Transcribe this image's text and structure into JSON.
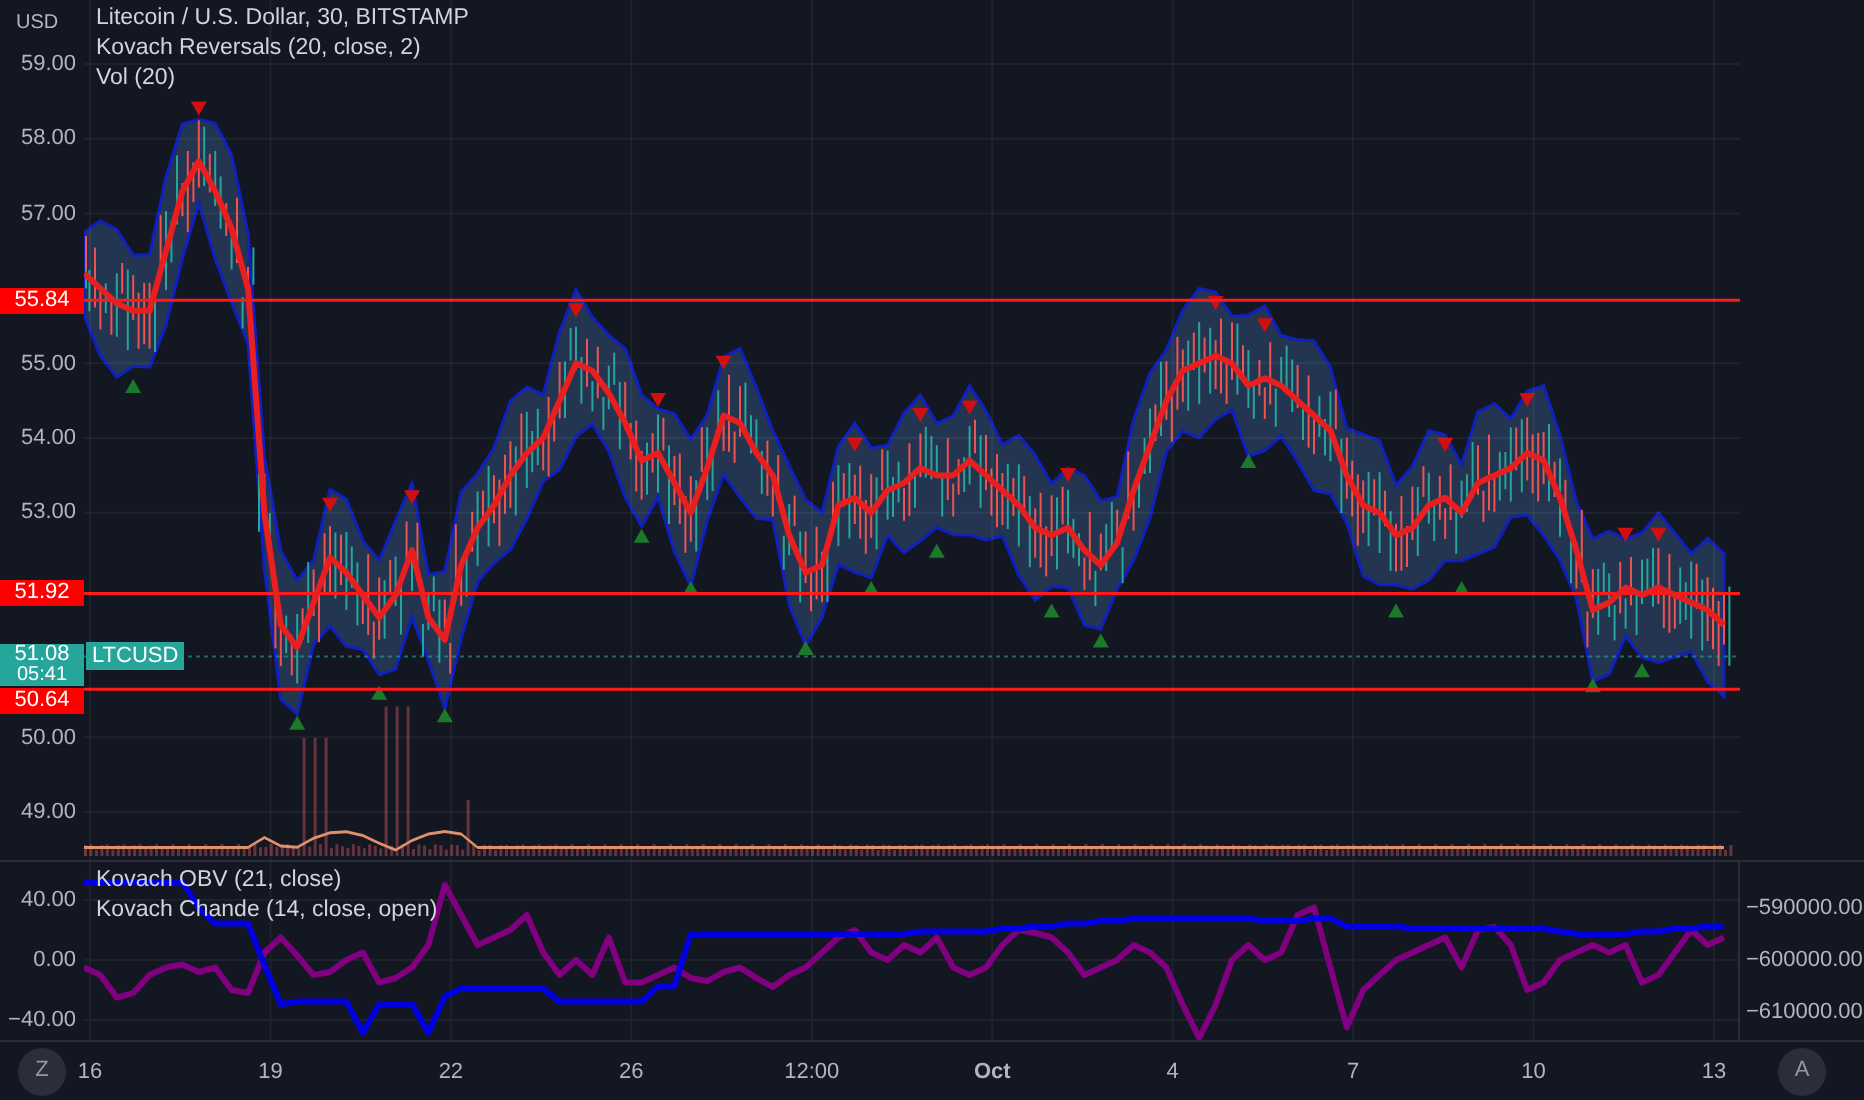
{
  "legend": [
    "Litecoin / U.S. Dollar, 30, BITSTAMP",
    "Kovach Reversals (20, close, 2)",
    "Vol (20)"
  ],
  "currency": "USD",
  "price_chart": {
    "chart_data": {
      "type": "line",
      "grid": true,
      "ylim": [
        49,
        59
      ],
      "yticks": [
        {
          "value": 49,
          "label": "49.00"
        },
        {
          "value": 50,
          "label": "50.00"
        },
        {
          "value": 53,
          "label": "53.00"
        },
        {
          "value": 54,
          "label": "54.00"
        },
        {
          "value": 55,
          "label": "55.00"
        },
        {
          "value": 57,
          "label": "57.00"
        },
        {
          "value": 58,
          "label": "58.00"
        },
        {
          "value": 59,
          "label": "59.00"
        }
      ],
      "series": [
        {
          "color": "#e91e1e",
          "values": [
            56.2,
            56.0,
            55.8,
            55.7,
            55.7,
            56.5,
            57.3,
            57.7,
            57.3,
            56.8,
            56.0,
            53.0,
            51.5,
            51.2,
            51.8,
            52.4,
            52.2,
            51.9,
            51.6,
            51.9,
            52.5,
            51.6,
            51.3,
            52.3,
            52.8,
            53.1,
            53.5,
            53.8,
            54.0,
            54.5,
            55.0,
            54.9,
            54.6,
            54.2,
            53.7,
            53.8,
            53.4,
            53.0,
            53.6,
            54.3,
            54.2,
            53.8,
            53.5,
            52.7,
            52.2,
            52.3,
            53.1,
            53.2,
            53.0,
            53.3,
            53.4,
            53.6,
            53.5,
            53.5,
            53.7,
            53.5,
            53.3,
            53.1,
            52.8,
            52.7,
            52.8,
            52.5,
            52.3,
            52.6,
            53.3,
            53.9,
            54.5,
            54.9,
            55.0,
            55.1,
            55.0,
            54.7,
            54.8,
            54.7,
            54.5,
            54.3,
            54.1,
            53.5,
            53.1,
            53.0,
            52.7,
            52.8,
            53.1,
            53.2,
            53.0,
            53.4,
            53.5,
            53.6,
            53.8,
            53.7,
            53.2,
            52.5,
            51.7,
            51.8,
            52.0,
            51.9,
            52.0,
            51.9,
            51.8,
            51.7,
            51.5
          ]
        }
      ]
    },
    "levels": [
      {
        "label": "55.84"
      },
      {
        "label": "51.92"
      },
      {
        "label": "50.64"
      }
    ],
    "last_price": {
      "price": "51.08",
      "countdown": "05:41",
      "symbol": "LTCUSD"
    }
  },
  "oscillator_legend": [
    "Kovach OBV (21, close)",
    "Kovach Chande (14, close, open)"
  ],
  "chande_chart": {
    "chart_data": {
      "type": "line",
      "grid": true,
      "ylim": [
        -53.3,
        65.3
      ],
      "yticks": [
        {
          "value": 40,
          "label": "40.00"
        },
        {
          "value": 0,
          "label": "0.00"
        },
        {
          "value": -40,
          "label": "−40.00"
        }
      ],
      "series": [
        {
          "color": "#800080",
          "values": [
            -5,
            -10,
            -25,
            -22,
            -10,
            -5,
            -3,
            -8,
            -5,
            -20,
            -22,
            5,
            15,
            3,
            -10,
            -8,
            0,
            5,
            -15,
            -12,
            -5,
            10,
            50,
            30,
            10,
            15,
            20,
            30,
            5,
            -10,
            0,
            -10,
            15,
            -15,
            -15,
            -10,
            -5,
            -12,
            -14,
            -8,
            -5,
            -12,
            -18,
            -10,
            -5,
            5,
            15,
            20,
            5,
            0,
            10,
            5,
            15,
            -5,
            -10,
            -5,
            10,
            20,
            18,
            15,
            5,
            -10,
            -5,
            0,
            10,
            5,
            -5,
            -30,
            -52,
            -30,
            0,
            10,
            0,
            5,
            30,
            35,
            -5,
            -45,
            -20,
            -10,
            0,
            5,
            10,
            15,
            -5,
            20,
            22,
            10,
            -20,
            -15,
            0,
            5,
            10,
            5,
            10,
            -15,
            -10,
            5,
            20,
            10,
            15
          ]
        }
      ]
    }
  },
  "obv_chart": {
    "chart_data": {
      "type": "line",
      "grid": false,
      "ylim": [
        -615380,
        -581150
      ],
      "yticks": [
        {
          "value": -590000,
          "label": "−590000.00"
        },
        {
          "value": -600000,
          "label": "−600000.00"
        },
        {
          "value": -610000,
          "label": "−610000.00"
        }
      ],
      "series": [
        {
          "color": "#0000e0",
          "values": [
            -585000,
            -585000,
            -585000,
            -585000,
            -585000,
            -585000,
            -585000,
            -590000,
            -593000,
            -593000,
            -593000,
            -601000,
            -608500,
            -608000,
            -608000,
            -608000,
            -608000,
            -614000,
            -608500,
            -608500,
            -608500,
            -614000,
            -607000,
            -605500,
            -605500,
            -605500,
            -605500,
            -605500,
            -605500,
            -608000,
            -608000,
            -608000,
            -608000,
            -608000,
            -608000,
            -605000,
            -605000,
            -595000,
            -595000,
            -595000,
            -595000,
            -595000,
            -595000,
            -595000,
            -595000,
            -595000,
            -595000,
            -595000,
            -595000,
            -595000,
            -595000,
            -594500,
            -594500,
            -594500,
            -594500,
            -594500,
            -594000,
            -594000,
            -593500,
            -593500,
            -593000,
            -593000,
            -592500,
            -592500,
            -592000,
            -592000,
            -592000,
            -592000,
            -592000,
            -592000,
            -592000,
            -592000,
            -592500,
            -592500,
            -592500,
            -592000,
            -592000,
            -593500,
            -593500,
            -593500,
            -593500,
            -594000,
            -594000,
            -594000,
            -594000,
            -594000,
            -594000,
            -594000,
            -594000,
            -594000,
            -594500,
            -595000,
            -595000,
            -595000,
            -595000,
            -594500,
            -594500,
            -594000,
            -594000,
            -593500,
            -593500
          ]
        }
      ]
    }
  },
  "time_axis": [
    {
      "label": "16",
      "kind": "day"
    },
    {
      "label": "19",
      "kind": "day"
    },
    {
      "label": "22",
      "kind": "day"
    },
    {
      "label": "26",
      "kind": "day"
    },
    {
      "label": "12:00",
      "kind": "time"
    },
    {
      "label": "Oct",
      "kind": "month"
    },
    {
      "label": "4",
      "kind": "day"
    },
    {
      "label": "7",
      "kind": "day"
    },
    {
      "label": "10",
      "kind": "day"
    },
    {
      "label": "13",
      "kind": "day"
    }
  ],
  "buttons": [
    "Z",
    "A"
  ]
}
